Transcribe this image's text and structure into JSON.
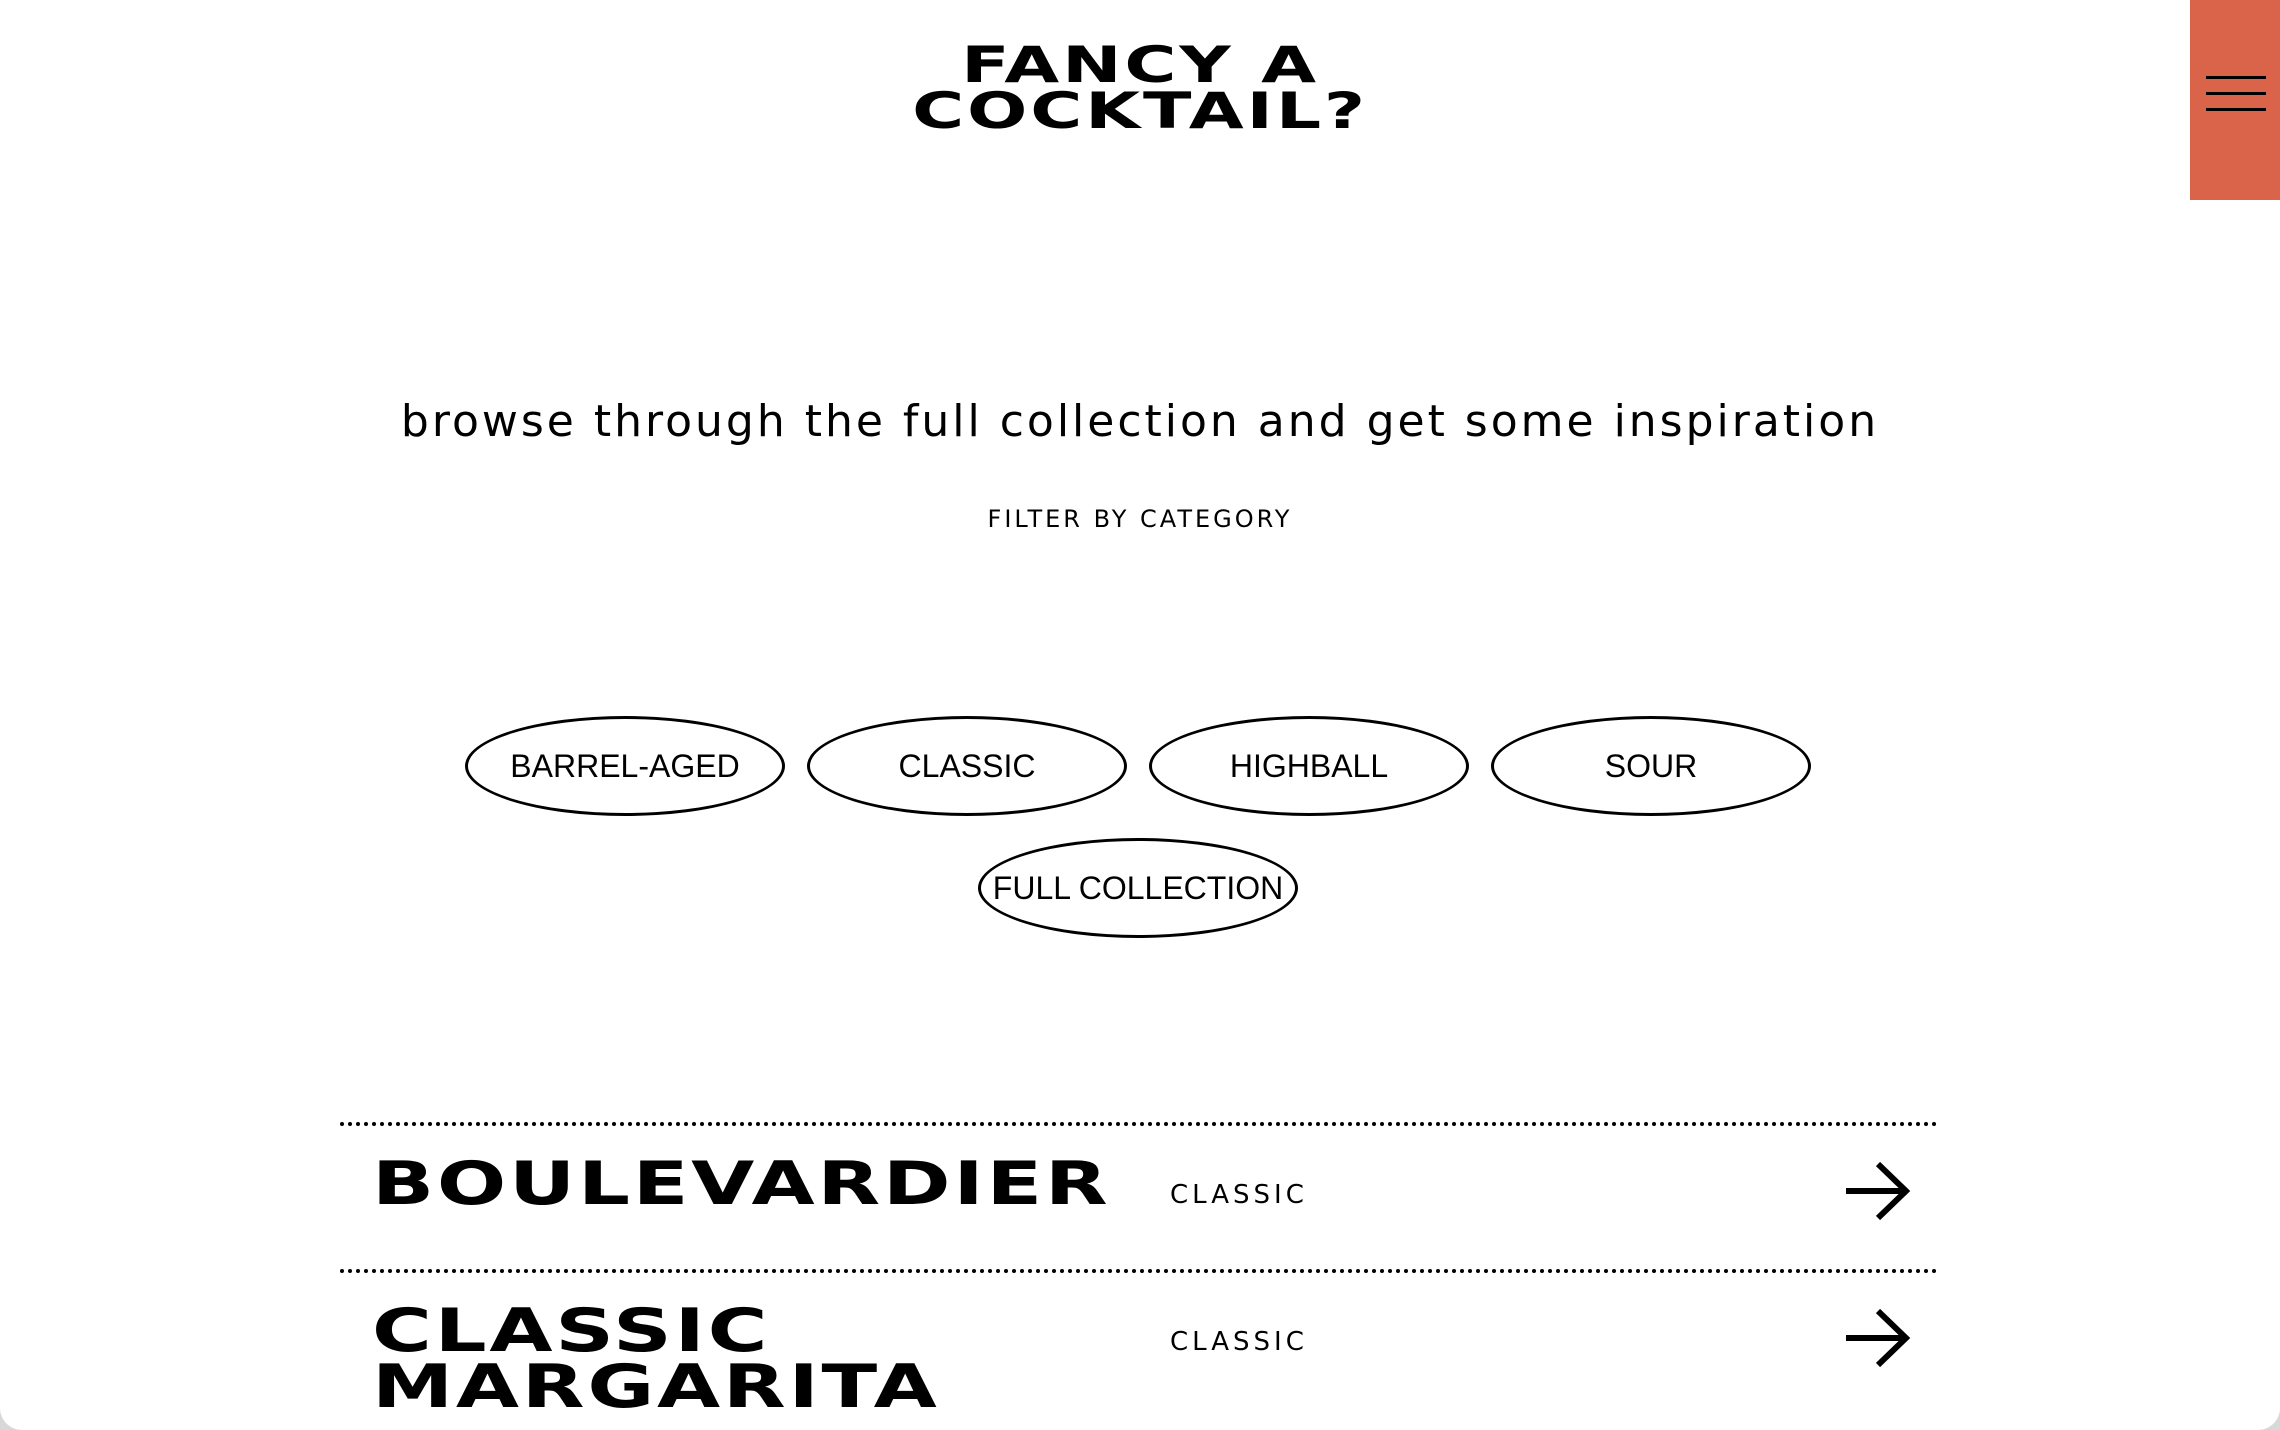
{
  "header": {
    "logo_line1": "FANCY A",
    "logo_line2": "COCKTAIL?",
    "menu_icon": "hamburger-menu-icon",
    "accent_color": "#d9644a"
  },
  "intro": {
    "tagline": "browse through the full collection and get some inspiration",
    "filter_label": "FILTER BY CATEGORY"
  },
  "filters": [
    "BARREL-AGED",
    "CLASSIC",
    "HIGHBALL",
    "SOUR",
    "FULL COLLECTION"
  ],
  "cocktails": [
    {
      "name": "BOULEVARDIER",
      "category": "CLASSIC",
      "icon": "arrow-right-icon"
    },
    {
      "name": "CLASSIC MARGARITA",
      "category": "CLASSIC",
      "icon": "arrow-right-icon"
    }
  ]
}
